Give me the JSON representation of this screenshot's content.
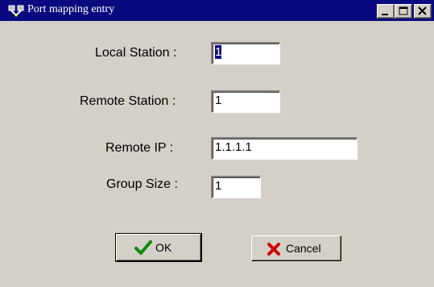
{
  "window": {
    "title": "Port mapping entry",
    "title_bar_color": "#0a0a80",
    "background_color": "#d4d0c8",
    "controls": [
      "minimize-icon",
      "maximize-icon",
      "close-icon"
    ]
  },
  "form": {
    "local_station": {
      "label": "Local Station :",
      "value": "1"
    },
    "remote_station": {
      "label": "Remote Station :",
      "value": "1"
    },
    "remote_ip": {
      "label": "Remote  IP :",
      "value": "1.1.1.1"
    },
    "group_size": {
      "label": "Group Size :",
      "value": "1"
    }
  },
  "buttons": {
    "ok": {
      "label": "OK",
      "icon": "checkmark-icon",
      "icon_color": "#0a8a0a"
    },
    "cancel": {
      "label": "Cancel",
      "icon": "x-icon",
      "icon_color": "#cc0000"
    }
  }
}
